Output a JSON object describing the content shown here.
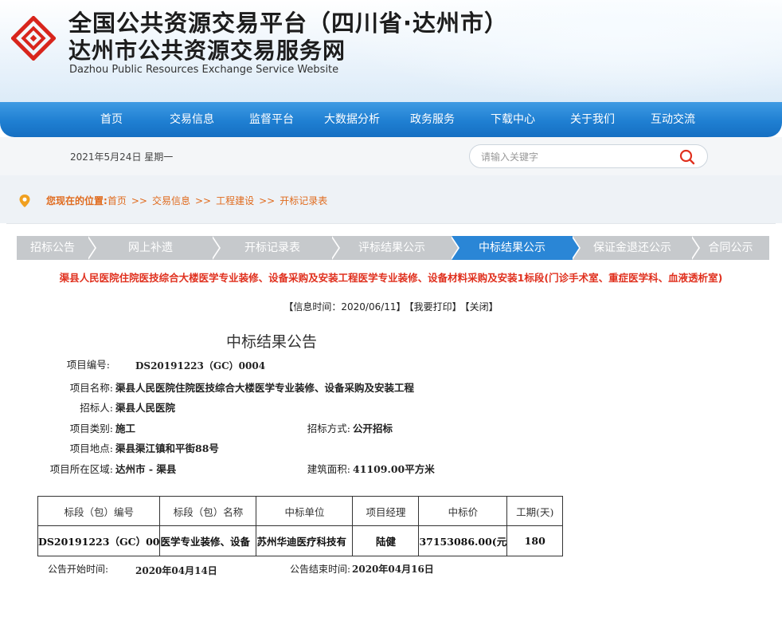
{
  "header": {
    "title_main": "全国公共资源交易平台（四川省·达州市）",
    "title_sub": "达州市公共资源交易服务网",
    "title_en": "Dazhou Public Resources Exchange Service Website",
    "logo_icon": "diamond-logo-icon",
    "brand_color": "#d8251c"
  },
  "nav": {
    "items": [
      {
        "label": "首页"
      },
      {
        "label": "交易信息"
      },
      {
        "label": "监督平台"
      },
      {
        "label": "大数据分析"
      },
      {
        "label": "政务服务"
      },
      {
        "label": "下载中心"
      },
      {
        "label": "关于我们"
      },
      {
        "label": "互动交流"
      }
    ],
    "color": "#1f7fd2"
  },
  "datebar": {
    "date": "2021年5月24日 星期一",
    "search_placeholder": "请输入关键字",
    "search_icon": "search-icon"
  },
  "breadcrumb": {
    "label": "您现在的位置:",
    "items": [
      {
        "label": "首页"
      },
      {
        "label": "交易信息"
      },
      {
        "label": "工程建设"
      },
      {
        "label": "开标记录表"
      }
    ],
    "separator": ">>",
    "color": "#e06b1e"
  },
  "stages": {
    "items": [
      {
        "label": "招标公告"
      },
      {
        "label": "网上补遗"
      },
      {
        "label": "开标记录表"
      },
      {
        "label": "评标结果公示"
      },
      {
        "label": "中标结果公示"
      },
      {
        "label": "保证金退还公示"
      },
      {
        "label": "合同公示"
      }
    ],
    "active_index": 4,
    "active_color": "#2a86d6",
    "inactive_color": "#c6c9cc"
  },
  "project_title": "渠县人民医院住院医技综合大楼医学专业装修、设备采购及安装工程医学专业装修、设备材料采购及安装1标段(门诊手术室、重症医学科、血液透析室)",
  "info": {
    "time": "【信息时间：2020/06/11】",
    "print": "【我要打印】",
    "close": "【关闭】"
  },
  "doc": {
    "title": "中标结果公告",
    "fields": {
      "code_label": "项目编号:",
      "code": "DS20191223（GC）0004",
      "name_label": "项目名称:",
      "name": "渠县人民医院住院医技综合大楼医学专业装修、设备采购及安装工程",
      "tenderer_label": "招标人:",
      "tenderer": "渠县人民医院",
      "category_label": "项目类别:",
      "category": "施工",
      "method_label": "招标方式:",
      "method": "公开招标",
      "location_label": "项目地点:",
      "location": "渠县渠江镇和平街88号",
      "region_label": "项目所在区域:",
      "region": "达州市 - 渠县",
      "area_label": "建筑面积:",
      "area": "41109.00平方米"
    },
    "table": {
      "headers": [
        "标段（包）编号",
        "标段（包）名称",
        "中标单位",
        "项目经理",
        "中标价",
        "工期(天)"
      ],
      "rows": [
        [
          "DS20191223（GC）00",
          "医学专业装修、设备",
          "苏州华迪医疗科技有",
          "陆健",
          "37153086.00(元",
          "180"
        ]
      ]
    },
    "notice": {
      "start_label": "公告开始时间:",
      "start": "2020年04月14日",
      "end_label": "公告结束时间:",
      "end": "2020年04月16日"
    }
  }
}
